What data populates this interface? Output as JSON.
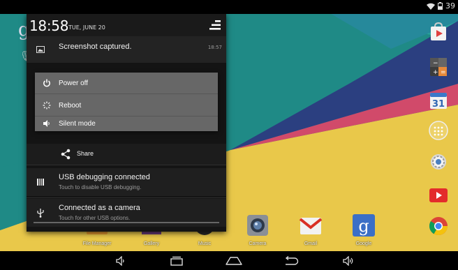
{
  "status_bar": {
    "battery_text": "39",
    "wifi_icon": "wifi-icon",
    "battery_icon": "battery-icon"
  },
  "shade": {
    "time": "18:58",
    "date": "TUE, JUNE 20",
    "settings_icon": "quick-settings-icon"
  },
  "notifications": {
    "screenshot": {
      "title": "Screenshot captured.",
      "time": "18:57",
      "icon": "image-icon"
    },
    "share": {
      "label": "Share",
      "icon": "share-icon"
    },
    "usb_debug": {
      "title": "USB debugging connected",
      "subtitle": "Touch to disable USB debugging.",
      "icon": "usb-debug-icon"
    },
    "camera": {
      "title": "Connected as a camera",
      "subtitle": "Touch for other USB options.",
      "icon": "usb-icon"
    }
  },
  "power_menu": {
    "power_off": {
      "label": "Power off",
      "icon": "power-icon"
    },
    "reboot": {
      "label": "Reboot",
      "icon": "reboot-icon"
    },
    "silent": {
      "label": "Silent mode",
      "icon": "volume-icon"
    }
  },
  "bottom_dock": [
    {
      "label": "File Manager",
      "icon": "file-manager-icon"
    },
    {
      "label": "Gallery",
      "icon": "gallery-icon"
    },
    {
      "label": "Music",
      "icon": "music-icon"
    },
    {
      "label": "Camera",
      "icon": "camera-icon"
    },
    {
      "label": "Gmail",
      "icon": "gmail-icon"
    },
    {
      "label": "Google",
      "icon": "google-icon"
    }
  ],
  "right_dock": [
    {
      "icon": "play-store-icon"
    },
    {
      "icon": "calculator-icon"
    },
    {
      "icon": "calendar-icon",
      "text": "31"
    },
    {
      "icon": "app-drawer-icon"
    },
    {
      "icon": "settings-gear-icon"
    },
    {
      "icon": "youtube-icon"
    },
    {
      "icon": "chrome-icon"
    }
  ],
  "wallpaper": {
    "teal": "#1f8a86",
    "yellow": "#e9c84a",
    "blue": "#2a3c7a",
    "magenta": "#c8275a"
  },
  "nav_bar": {
    "volume_down_icon": "volume-down-icon",
    "recents_icon": "recents-icon",
    "home_icon": "home-icon",
    "back_icon": "back-icon",
    "volume_up_icon": "volume-up-icon"
  }
}
